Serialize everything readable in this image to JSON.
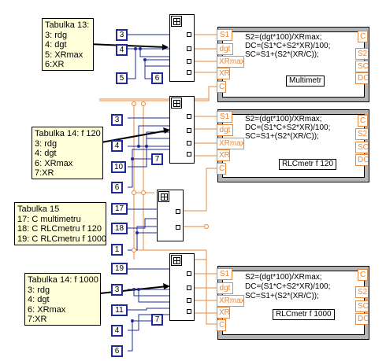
{
  "notes": {
    "n13": [
      "Tabulka 13:",
      "3: rdg",
      "4: dgt",
      "5: XRmax",
      "6:XR"
    ],
    "n14a": [
      "Tabulka 14: f 120",
      "3: rdg",
      "4: dgt",
      "6: XRmax",
      "7:XR"
    ],
    "n15": [
      "Tabulka 15",
      "17: C multimetru",
      "18: C RLCmetru f 120",
      "19: C RLCmetru f 1000"
    ],
    "n14b": [
      "Tabulka 14: f 1000",
      "3: rdg",
      "4: dgt",
      "6: XRmax",
      "7:XR"
    ]
  },
  "constants": {
    "c1": "3",
    "c2": "4",
    "c3": "5",
    "c4": "6",
    "c5": "3",
    "c6": "4",
    "c7": "10",
    "c8": "6",
    "c9": "7",
    "c10": "17",
    "c11": "18",
    "c12": "1",
    "c13": "19",
    "c14": "3",
    "c15": "11",
    "c16": "4",
    "c17": "6",
    "c18": "7"
  },
  "formula_nodes": [
    {
      "lines": [
        "S2=(dgt*100)/XRmax;",
        "DC=(S1*C+S2*XR)/100;",
        "SC=S1+(S2*(XR/C));"
      ],
      "label": "Multimetr",
      "inputs": [
        "S1",
        "dgt",
        "XRmax",
        "XR",
        "C"
      ],
      "outputs": [
        "C",
        "S2",
        "SC",
        "DC"
      ]
    },
    {
      "lines": [
        "S2=(dgt*100)/XRmax;",
        "DC=(S1*C+S2*XR)/100;",
        "SC=S1+(S2*(XR/C));"
      ],
      "label": "RLCmetr f 120",
      "inputs": [
        "S1",
        "dgt",
        "XRmax",
        "XR",
        "C"
      ],
      "outputs": [
        "C",
        "S2",
        "SC",
        "DC"
      ]
    },
    {
      "lines": [
        "S2=(dgt*100)/XRmax;",
        "DC=(S1*C+S2*XR)/100;",
        "SC=S1+(S2*(XR/C));"
      ],
      "label": "RLCmetr f 1000",
      "inputs": [
        "S1",
        "dgt",
        "XRmax",
        "XR",
        "C"
      ],
      "outputs": [
        "C",
        "S2",
        "SC",
        "DC"
      ]
    }
  ],
  "colors": {
    "wire_blue": "#1e2a9a",
    "wire_orange": "#e8883a",
    "note_fill": "#ffffd9",
    "frame_gray": "#b4b4b4"
  }
}
